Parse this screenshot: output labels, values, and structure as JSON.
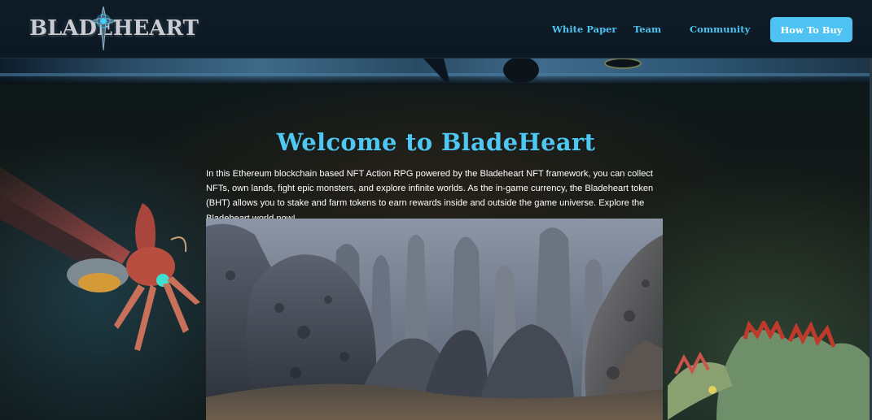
{
  "brand": {
    "logo_text": "BLADEHEART"
  },
  "nav": {
    "links": [
      {
        "label": "White Paper"
      },
      {
        "label": "Team"
      },
      {
        "label": "Community"
      }
    ],
    "cta_label": "How To Buy"
  },
  "main": {
    "title": "Welcome to BladeHeart",
    "intro": "In this Ethereum blockchain based NFT Action RPG powered by the Bladeheart NFT framework, you can collect NFTs, own lands, fight epic monsters, and explore infinite worlds. As the in-game currency, the Bladeheart token (BHT) allows you to stake and farm tokens to earn rewards inside and outside the game universe. Explore the Bladeheart world now!"
  },
  "colors": {
    "accent": "#4ec3f3",
    "title": "#4ec7f2",
    "header_bg": "#0f1c27"
  },
  "icons": {
    "logo_emblem": "sword-star-emblem"
  }
}
